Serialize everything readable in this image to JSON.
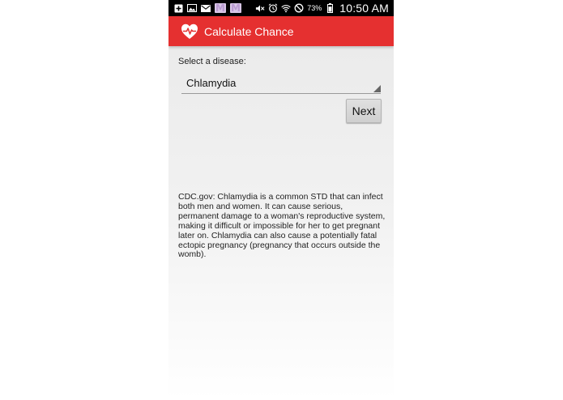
{
  "status_bar": {
    "left_icons": [
      "add-box-icon",
      "image-icon",
      "mail-icon",
      "gmail-icon",
      "gmail-icon"
    ],
    "right_icons": [
      "mute-icon",
      "alarm-icon",
      "wifi-icon",
      "blocked-icon",
      "battery-icon"
    ],
    "gmail_letter": "M",
    "battery": "73%",
    "time": "10:50 AM"
  },
  "app_bar": {
    "icon": "heart-pulse-icon",
    "title": "Calculate Chance",
    "color": "#e53030"
  },
  "form": {
    "select_label": "Select a disease:",
    "selected_disease": "Chlamydia",
    "next_label": "Next"
  },
  "description": "CDC.gov: Chlamydia is a common STD that can infect both men and women. It can cause serious, permanent damage to a woman's reproductive system, making it difficult or impossible for her to get pregnant later on. Chlamydia can also cause a potentially fatal ectopic pregnancy (pregnancy that occurs outside the womb)."
}
